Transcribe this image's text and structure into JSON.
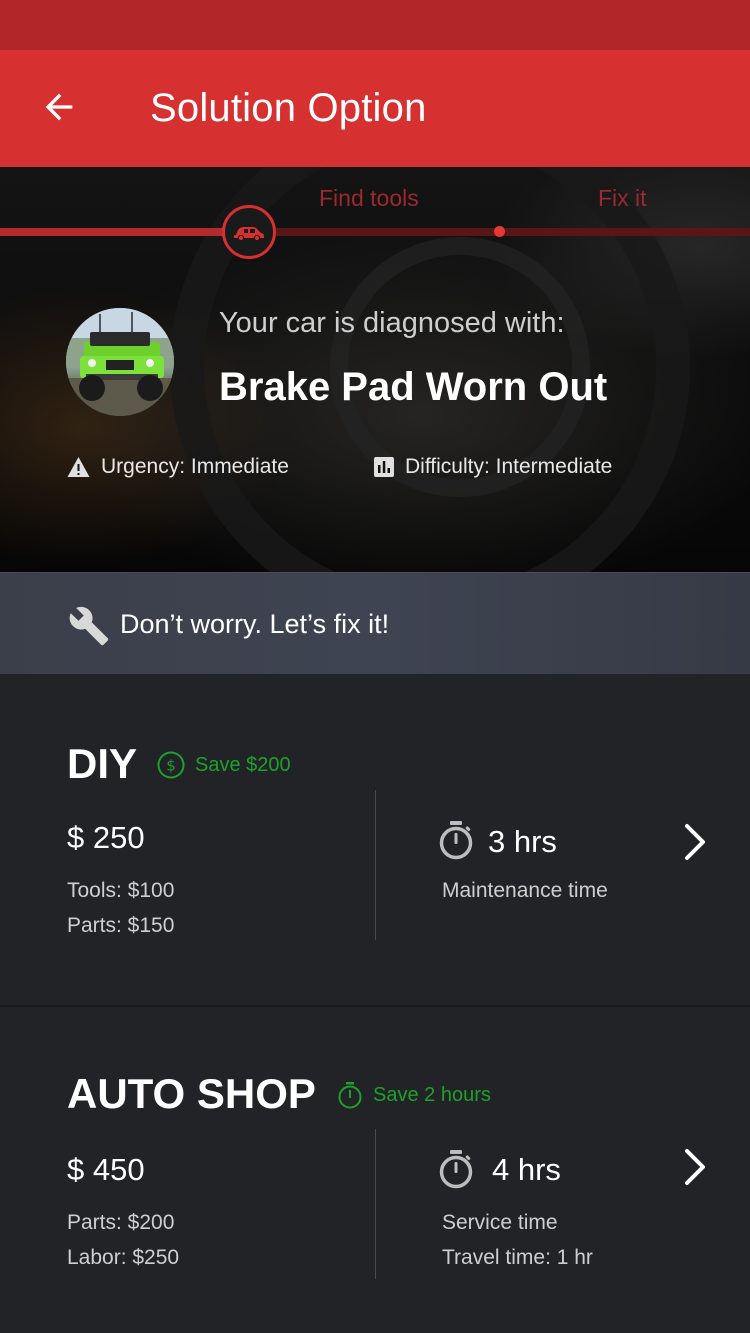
{
  "app_bar": {
    "title": "Solution Option",
    "back_icon": "arrow-left-icon"
  },
  "progress": {
    "steps": [
      "Find tools",
      "Fix it"
    ],
    "current_step_icon": "car-icon"
  },
  "diagnosis": {
    "label": "Your car is diagnosed with:",
    "value": "Brake Pad Worn Out",
    "urgency": "Urgency: Immediate",
    "difficulty": "Difficulty: Intermediate"
  },
  "banner": {
    "text": "Don’t worry. Let’s fix it!",
    "icon": "wrench-icon"
  },
  "options": [
    {
      "title": "DIY",
      "save": "Save $200",
      "save_icon": "dollar-circle-icon",
      "price": "$ 250",
      "lines": [
        "Tools:  $100",
        "Parts:  $150"
      ],
      "time": "3 hrs",
      "time_labels": [
        "Maintenance time"
      ]
    },
    {
      "title": "AUTO SHOP",
      "save": "Save 2 hours",
      "save_icon": "timer-icon",
      "price": "$ 450",
      "lines": [
        "Parts:  $200",
        "Labor:  $250"
      ],
      "time": "4 hrs",
      "time_labels": [
        "Service time",
        "Travel time: 1 hr"
      ]
    }
  ],
  "colors": {
    "primary": "#d63031",
    "status_bar": "#b2262a",
    "save_green": "#1da12a",
    "card_bg": "#222327"
  }
}
